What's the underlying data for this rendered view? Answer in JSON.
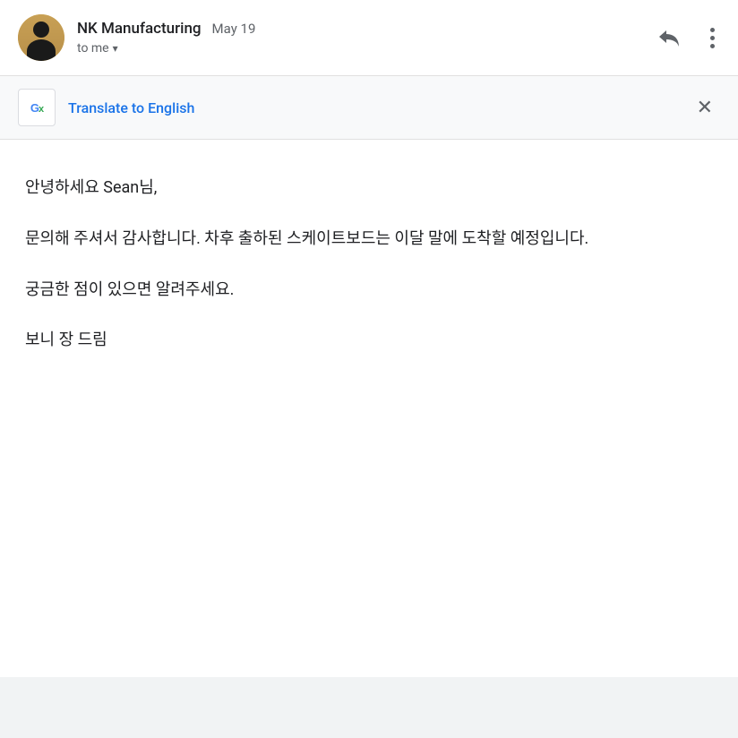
{
  "header": {
    "sender_name": "NK Manufacturing",
    "date": "May 19",
    "to_label": "to me",
    "chevron": "▾",
    "reply_label": "Reply",
    "more_label": "More options"
  },
  "translate_banner": {
    "icon_text": "Gx",
    "link_text": "Translate to English",
    "close_label": "Close"
  },
  "email_body": {
    "greeting": "안녕하세요 Sean님,",
    "paragraph1": "문의해 주셔서 감사합니다. 차후 출하된 스케이트보드는 이달 말에 도착할 예정입니다.",
    "paragraph2": "궁금한 점이 있으면 알려주세요.",
    "closing": "보니 장 드림"
  }
}
